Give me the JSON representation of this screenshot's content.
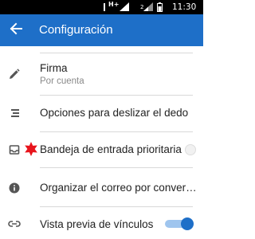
{
  "status_bar": {
    "network_type": "H+",
    "sim_slot": "2",
    "time": "11:30"
  },
  "toolbar": {
    "title": "Configuración",
    "back_icon": "arrow-back-icon"
  },
  "settings": [
    {
      "label": "Firma",
      "sublabel": "Por cuenta",
      "icon": "pencil-icon"
    },
    {
      "label": "Opciones para deslizar el dedo",
      "icon": "swipe-lines-icon"
    },
    {
      "label": "Bandeja de entrada prioritaria",
      "icon": "inbox-icon",
      "badge": "red-star-badge",
      "toggle_on": false
    },
    {
      "label": "Organizar el correo por conver…",
      "icon": "info-icon"
    },
    {
      "label": "Vista previa de vínculos",
      "icon": "link-icon",
      "toggle_on": true
    }
  ],
  "colors": {
    "toolbar": "#1e6fc8",
    "status_bar": "#000000",
    "switch_on": "#1e6fc8",
    "badge": "#e8141c"
  }
}
